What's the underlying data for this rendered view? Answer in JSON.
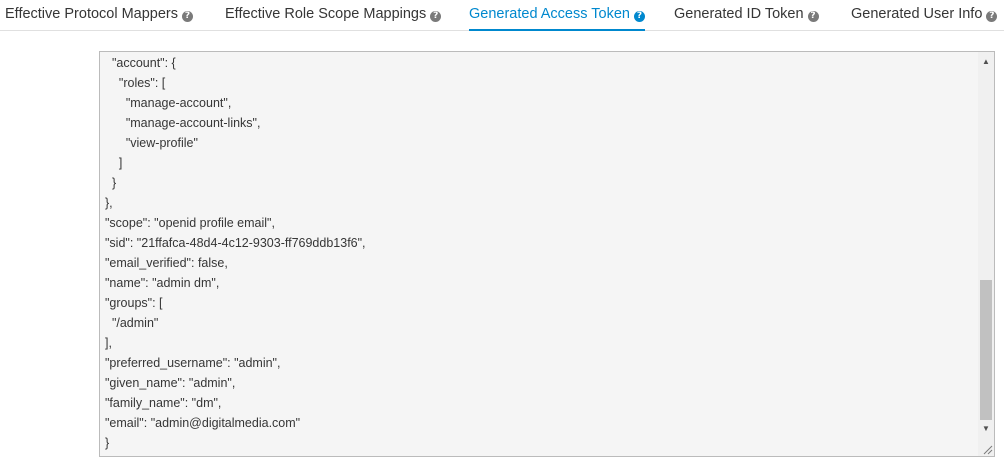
{
  "tabs": [
    {
      "label": "Effective Protocol Mappers",
      "icon": "help-circle-icon",
      "active": false
    },
    {
      "label": "Effective Role Scope Mappings",
      "icon": "help-circle-icon",
      "active": false
    },
    {
      "label": "Generated Access Token",
      "icon": "help-circle-icon",
      "active": true
    },
    {
      "label": "Generated ID Token",
      "icon": "help-circle-icon",
      "active": false
    },
    {
      "label": "Generated User Info",
      "icon": "help-circle-icon",
      "active": false
    }
  ],
  "help_glyph": "?",
  "token": {
    "lines": [
      "  \"account\": {",
      "    \"roles\": [",
      "      \"manage-account\",",
      "      \"manage-account-links\",",
      "      \"view-profile\"",
      "    ]",
      "  }",
      "},",
      "\"scope\": \"openid profile email\",",
      "\"sid\": \"21ffafca-48d4-4c12-9303-ff769ddb13f6\",",
      "\"email_verified\": false,",
      "\"name\": \"admin dm\",",
      "\"groups\": [",
      "  \"/admin\"",
      "],",
      "\"preferred_username\": \"admin\",",
      "\"given_name\": \"admin\",",
      "\"family_name\": \"dm\",",
      "\"email\": \"admin@digitalmedia.com\"",
      "}"
    ]
  },
  "scrollbar": {
    "up_glyph": "▲",
    "down_glyph": "▼",
    "position_fraction": 0.65
  },
  "colors": {
    "accent": "#0088ce",
    "text": "#363636",
    "panel_bg": "#f5f5f5"
  }
}
